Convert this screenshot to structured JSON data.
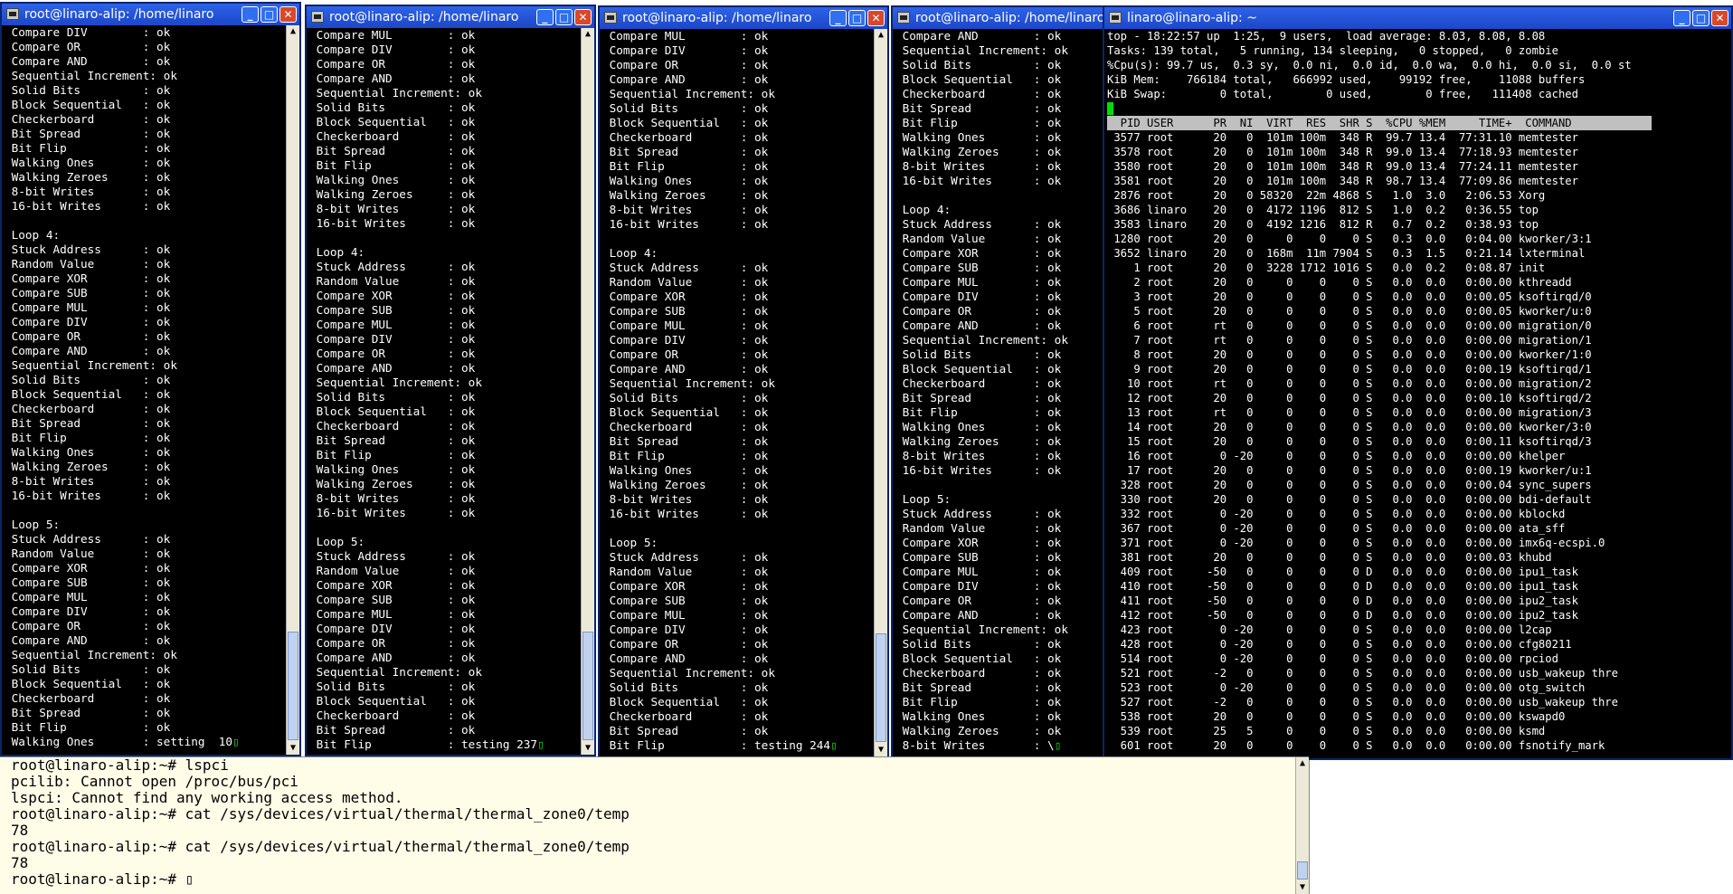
{
  "colors": {
    "titlebar": "#1c47c9",
    "terminal_bg": "#000000",
    "terminal_fg": "#ffffff",
    "cursor": "#00e000",
    "bottom_bg": "#fffde8"
  },
  "icons": {
    "terminal": "terminal-icon",
    "minimize": "minimize-icon",
    "maximize": "maximize-icon",
    "close": "close-icon",
    "scroll_up": "scroll-up-icon",
    "scroll_down": "scroll-down-icon"
  },
  "buttons": {
    "min": "_",
    "max": "□",
    "close": "✕",
    "up": "▲",
    "down": "▼"
  },
  "windows": [
    {
      "title": "root@linaro-alip: /home/linaro",
      "lines": [
        "Compare DIV        : ok",
        "Compare OR         : ok",
        "Compare AND        : ok",
        "Sequential Increment: ok",
        "Solid Bits         : ok",
        "Block Sequential   : ok",
        "Checkerboard       : ok",
        "Bit Spread         : ok",
        "Bit Flip           : ok",
        "Walking Ones       : ok",
        "Walking Zeroes     : ok",
        "8-bit Writes       : ok",
        "16-bit Writes      : ok",
        "",
        "Loop 4:",
        "Stuck Address      : ok",
        "Random Value       : ok",
        "Compare XOR        : ok",
        "Compare SUB        : ok",
        "Compare MUL        : ok",
        "Compare DIV        : ok",
        "Compare OR         : ok",
        "Compare AND        : ok",
        "Sequential Increment: ok",
        "Solid Bits         : ok",
        "Block Sequential   : ok",
        "Checkerboard       : ok",
        "Bit Spread         : ok",
        "Bit Flip           : ok",
        "Walking Ones       : ok",
        "Walking Zeroes     : ok",
        "8-bit Writes       : ok",
        "16-bit Writes      : ok",
        "",
        "Loop 5:",
        "Stuck Address      : ok",
        "Random Value       : ok",
        "Compare XOR        : ok",
        "Compare SUB        : ok",
        "Compare MUL        : ok",
        "Compare DIV        : ok",
        "Compare OR         : ok",
        "Compare AND        : ok",
        "Sequential Increment: ok",
        "Solid Bits         : ok",
        "Block Sequential   : ok",
        "Checkerboard       : ok",
        "Bit Spread         : ok",
        "Bit Flip           : ok"
      ],
      "last": "Walking Ones       : setting  10"
    },
    {
      "title": "root@linaro-alip: /home/linaro",
      "lines": [
        "Compare MUL        : ok",
        "Compare DIV        : ok",
        "Compare OR         : ok",
        "Compare AND        : ok",
        "Sequential Increment: ok",
        "Solid Bits         : ok",
        "Block Sequential   : ok",
        "Checkerboard       : ok",
        "Bit Spread         : ok",
        "Bit Flip           : ok",
        "Walking Ones       : ok",
        "Walking Zeroes     : ok",
        "8-bit Writes       : ok",
        "16-bit Writes      : ok",
        "",
        "Loop 4:",
        "Stuck Address      : ok",
        "Random Value       : ok",
        "Compare XOR        : ok",
        "Compare SUB        : ok",
        "Compare MUL        : ok",
        "Compare DIV        : ok",
        "Compare OR         : ok",
        "Compare AND        : ok",
        "Sequential Increment: ok",
        "Solid Bits         : ok",
        "Block Sequential   : ok",
        "Checkerboard       : ok",
        "Bit Spread         : ok",
        "Bit Flip           : ok",
        "Walking Ones       : ok",
        "Walking Zeroes     : ok",
        "8-bit Writes       : ok",
        "16-bit Writes      : ok",
        "",
        "Loop 5:",
        "Stuck Address      : ok",
        "Random Value       : ok",
        "Compare XOR        : ok",
        "Compare SUB        : ok",
        "Compare MUL        : ok",
        "Compare DIV        : ok",
        "Compare OR         : ok",
        "Compare AND        : ok",
        "Sequential Increment: ok",
        "Solid Bits         : ok",
        "Block Sequential   : ok",
        "Checkerboard       : ok",
        "Bit Spread         : ok"
      ],
      "last": "Bit Flip           : testing 237"
    },
    {
      "title": "root@linaro-alip: /home/linaro",
      "lines": [
        "Compare MUL        : ok",
        "Compare DIV        : ok",
        "Compare OR         : ok",
        "Compare AND        : ok",
        "Sequential Increment: ok",
        "Solid Bits         : ok",
        "Block Sequential   : ok",
        "Checkerboard       : ok",
        "Bit Spread         : ok",
        "Bit Flip           : ok",
        "Walking Ones       : ok",
        "Walking Zeroes     : ok",
        "8-bit Writes       : ok",
        "16-bit Writes      : ok",
        "",
        "Loop 4:",
        "Stuck Address      : ok",
        "Random Value       : ok",
        "Compare XOR        : ok",
        "Compare SUB        : ok",
        "Compare MUL        : ok",
        "Compare DIV        : ok",
        "Compare OR         : ok",
        "Compare AND        : ok",
        "Sequential Increment: ok",
        "Solid Bits         : ok",
        "Block Sequential   : ok",
        "Checkerboard       : ok",
        "Bit Spread         : ok",
        "Bit Flip           : ok",
        "Walking Ones       : ok",
        "Walking Zeroes     : ok",
        "8-bit Writes       : ok",
        "16-bit Writes      : ok",
        "",
        "Loop 5:",
        "Stuck Address      : ok",
        "Random Value       : ok",
        "Compare XOR        : ok",
        "Compare SUB        : ok",
        "Compare MUL        : ok",
        "Compare DIV        : ok",
        "Compare OR         : ok",
        "Compare AND        : ok",
        "Sequential Increment: ok",
        "Solid Bits         : ok",
        "Block Sequential   : ok",
        "Checkerboard       : ok",
        "Bit Spread         : ok"
      ],
      "last": "Bit Flip           : testing 244"
    },
    {
      "title": "root@linaro-alip: /home/linaro",
      "lines": [
        "Compare AND        : ok",
        "Sequential Increment: ok",
        "Solid Bits         : ok",
        "Block Sequential   : ok",
        "Checkerboard       : ok",
        "Bit Spread         : ok",
        "Bit Flip           : ok",
        "Walking Ones       : ok",
        "Walking Zeroes     : ok",
        "8-bit Writes       : ok",
        "16-bit Writes      : ok",
        "",
        "Loop 4:",
        "Stuck Address      : ok",
        "Random Value       : ok",
        "Compare XOR        : ok",
        "Compare SUB        : ok",
        "Compare MUL        : ok",
        "Compare DIV        : ok",
        "Compare OR         : ok",
        "Compare AND        : ok",
        "Sequential Increment: ok",
        "Solid Bits         : ok",
        "Block Sequential   : ok",
        "Checkerboard       : ok",
        "Bit Spread         : ok",
        "Bit Flip           : ok",
        "Walking Ones       : ok",
        "Walking Zeroes     : ok",
        "8-bit Writes       : ok",
        "16-bit Writes      : ok",
        "",
        "Loop 5:",
        "Stuck Address      : ok",
        "Random Value       : ok",
        "Compare XOR        : ok",
        "Compare SUB        : ok",
        "Compare MUL        : ok",
        "Compare DIV        : ok",
        "Compare OR         : ok",
        "Compare AND        : ok",
        "Sequential Increment: ok",
        "Solid Bits         : ok",
        "Block Sequential   : ok",
        "Checkerboard       : ok",
        "Bit Spread         : ok",
        "Bit Flip           : ok",
        "Walking Ones       : ok",
        "Walking Zeroes     : ok"
      ],
      "last": "8-bit Writes       : \\"
    }
  ],
  "top": {
    "title": "linaro@linaro-alip: ~",
    "summary": [
      "top - 18:22:57 up  1:25,  9 users,  load average: 8.03, 8.08, 8.08",
      "Tasks: 139 total,   5 running, 134 sleeping,   0 stopped,   0 zombie",
      "%Cpu(s): 99.7 us,  0.3 sy,  0.0 ni,  0.0 id,  0.0 wa,  0.0 hi,  0.0 si,  0.0 st",
      "KiB Mem:    766184 total,   666992 used,    99192 free,    11088 buffers",
      "KiB Swap:        0 total,        0 used,        0 free,   111408 cached"
    ],
    "header": "  PID USER      PR  NI  VIRT  RES  SHR S  %CPU %MEM     TIME+  COMMAND            ",
    "rows": [
      " 3577 root      20   0  101m 100m  348 R  99.7 13.4  77:31.10 memtester",
      " 3578 root      20   0  101m 100m  348 R  99.0 13.4  77:18.93 memtester",
      " 3580 root      20   0  101m 100m  348 R  99.0 13.4  77:24.11 memtester",
      " 3581 root      20   0  101m 100m  348 R  98.7 13.4  77:09.86 memtester",
      " 2876 root      20   0 58320  22m 4868 S   1.0  3.0   2:06.53 Xorg",
      " 3686 linaro    20   0  4172 1196  812 S   1.0  0.2   0:36.55 top",
      " 3583 linaro    20   0  4192 1216  812 R   0.7  0.2   0:38.93 top",
      " 1280 root      20   0     0    0    0 S   0.3  0.0   0:04.00 kworker/3:1",
      " 3652 linaro    20   0  168m  11m 7904 S   0.3  1.5   0:21.14 lxterminal",
      "    1 root      20   0  3228 1712 1016 S   0.0  0.2   0:08.87 init",
      "    2 root      20   0     0    0    0 S   0.0  0.0   0:00.00 kthreadd",
      "    3 root      20   0     0    0    0 S   0.0  0.0   0:00.05 ksoftirqd/0",
      "    5 root      20   0     0    0    0 S   0.0  0.0   0:00.05 kworker/u:0",
      "    6 root      rt   0     0    0    0 S   0.0  0.0   0:00.00 migration/0",
      "    7 root      rt   0     0    0    0 S   0.0  0.0   0:00.00 migration/1",
      "    8 root      20   0     0    0    0 S   0.0  0.0   0:00.00 kworker/1:0",
      "    9 root      20   0     0    0    0 S   0.0  0.0   0:00.19 ksoftirqd/1",
      "   10 root      rt   0     0    0    0 S   0.0  0.0   0:00.00 migration/2",
      "   12 root      20   0     0    0    0 S   0.0  0.0   0:00.10 ksoftirqd/2",
      "   13 root      rt   0     0    0    0 S   0.0  0.0   0:00.00 migration/3",
      "   14 root      20   0     0    0    0 S   0.0  0.0   0:00.00 kworker/3:0",
      "   15 root      20   0     0    0    0 S   0.0  0.0   0:00.11 ksoftirqd/3",
      "   16 root       0 -20     0    0    0 S   0.0  0.0   0:00.00 khelper",
      "   17 root      20   0     0    0    0 S   0.0  0.0   0:00.19 kworker/u:1",
      "  328 root      20   0     0    0    0 S   0.0  0.0   0:00.04 sync_supers",
      "  330 root      20   0     0    0    0 S   0.0  0.0   0:00.00 bdi-default",
      "  332 root       0 -20     0    0    0 S   0.0  0.0   0:00.00 kblockd",
      "  367 root       0 -20     0    0    0 S   0.0  0.0   0:00.00 ata_sff",
      "  371 root       0 -20     0    0    0 S   0.0  0.0   0:00.00 imx6q-ecspi.0",
      "  381 root      20   0     0    0    0 S   0.0  0.0   0:00.03 khubd",
      "  409 root     -50   0     0    0    0 D   0.0  0.0   0:00.00 ipu1_task",
      "  410 root     -50   0     0    0    0 D   0.0  0.0   0:00.00 ipu1_task",
      "  411 root     -50   0     0    0    0 D   0.0  0.0   0:00.00 ipu2_task",
      "  412 root     -50   0     0    0    0 D   0.0  0.0   0:00.00 ipu2_task",
      "  423 root       0 -20     0    0    0 S   0.0  0.0   0:00.00 l2cap",
      "  428 root       0 -20     0    0    0 S   0.0  0.0   0:00.00 cfg80211",
      "  514 root       0 -20     0    0    0 S   0.0  0.0   0:00.00 rpciod",
      "  521 root      -2   0     0    0    0 S   0.0  0.0   0:00.00 usb_wakeup thre",
      "  523 root       0 -20     0    0    0 S   0.0  0.0   0:00.00 otg_switch",
      "  527 root      -2   0     0    0    0 S   0.0  0.0   0:00.00 usb_wakeup thre",
      "  538 root      20   0     0    0    0 S   0.0  0.0   0:00.00 kswapd0",
      "  539 root      25   5     0    0    0 S   0.0  0.0   0:00.00 ksmd",
      "  601 root      20   0     0    0    0 S   0.0  0.0   0:00.00 fsnotify_mark"
    ]
  },
  "bottom": {
    "lines": [
      "root@linaro-alip:~# lspci",
      "pcilib: Cannot open /proc/bus/pci",
      "lspci: Cannot find any working access method.",
      "root@linaro-alip:~# cat /sys/devices/virtual/thermal/thermal_zone0/temp",
      "78",
      "root@linaro-alip:~# cat /sys/devices/virtual/thermal/thermal_zone0/temp",
      "78"
    ],
    "prompt": "root@linaro-alip:~# "
  }
}
